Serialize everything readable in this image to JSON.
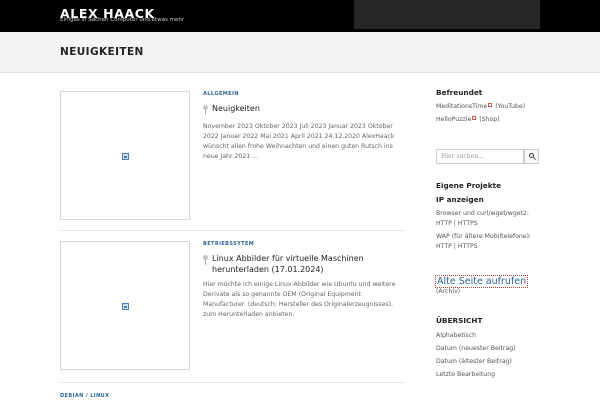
{
  "header": {
    "title": "ALEX HAACK",
    "tagline": "Einiges in Sachen Computer und etwas mehr"
  },
  "page": {
    "title": "NEUIGKEITEN"
  },
  "posts": [
    {
      "category": "ALLGEMEIN",
      "title": "Neuigkeiten",
      "excerpt": "November 2023 Oktober 2023 Juli 2023 Januar 2023 Oktober 2022 Januar 2022 Mai 2021 April 2021 24.12.2020 AlexHaack wünscht allen frohe Weihnachten und einen guten Rutsch ins neue Jahr 2021 ..."
    },
    {
      "category": "BETRIEBSSYTEM",
      "title": "Linux Abbilder für virtuelle Maschinen herunterladen (17.01.2024)",
      "excerpt": "Hier möchte ich einige Linux-Abbilder wie Ubuntu und weitere Derivate als so genannte OEM (Original Equipment Manufacturer. (deutsch: Hersteller des Originalerzeugnisses), zum Herunterladen anbieten."
    },
    {
      "category_a": "DEBIAN",
      "category_sep": " / ",
      "category_b": "LINUX"
    }
  ],
  "sidebar": {
    "befreundet": {
      "heading": "Befreundet",
      "item1_link": "MeditationsTime",
      "item1_extra": "(YouTube)",
      "item2_link": "HelloPuzzle",
      "item2_extra": "(Shop)"
    },
    "search": {
      "placeholder": "Hier suchen..."
    },
    "projects": {
      "heading": "Eigene Projekte",
      "ip_heading": "IP anzeigen",
      "browser_text": "Browser und curl/wget/wget2:",
      "browser_http": "HTTP",
      "browser_sep": " | ",
      "browser_https": "HTTPS",
      "wap_text": "WAP (für ältere Mobiltelefone):",
      "wap_http": "HTTP",
      "wap_sep": " | ",
      "wap_https": "HTTPS"
    },
    "old_site": {
      "link": "Alte Seite aufrufen",
      "note": "(Archiv)"
    },
    "overview": {
      "heading": "ÜBERSICHT",
      "items": [
        "Alphabetisch",
        "Datum (neuester Beitrag)",
        "Datum (ältester Beitrag)",
        "Letzte Bearbeitung"
      ]
    }
  }
}
